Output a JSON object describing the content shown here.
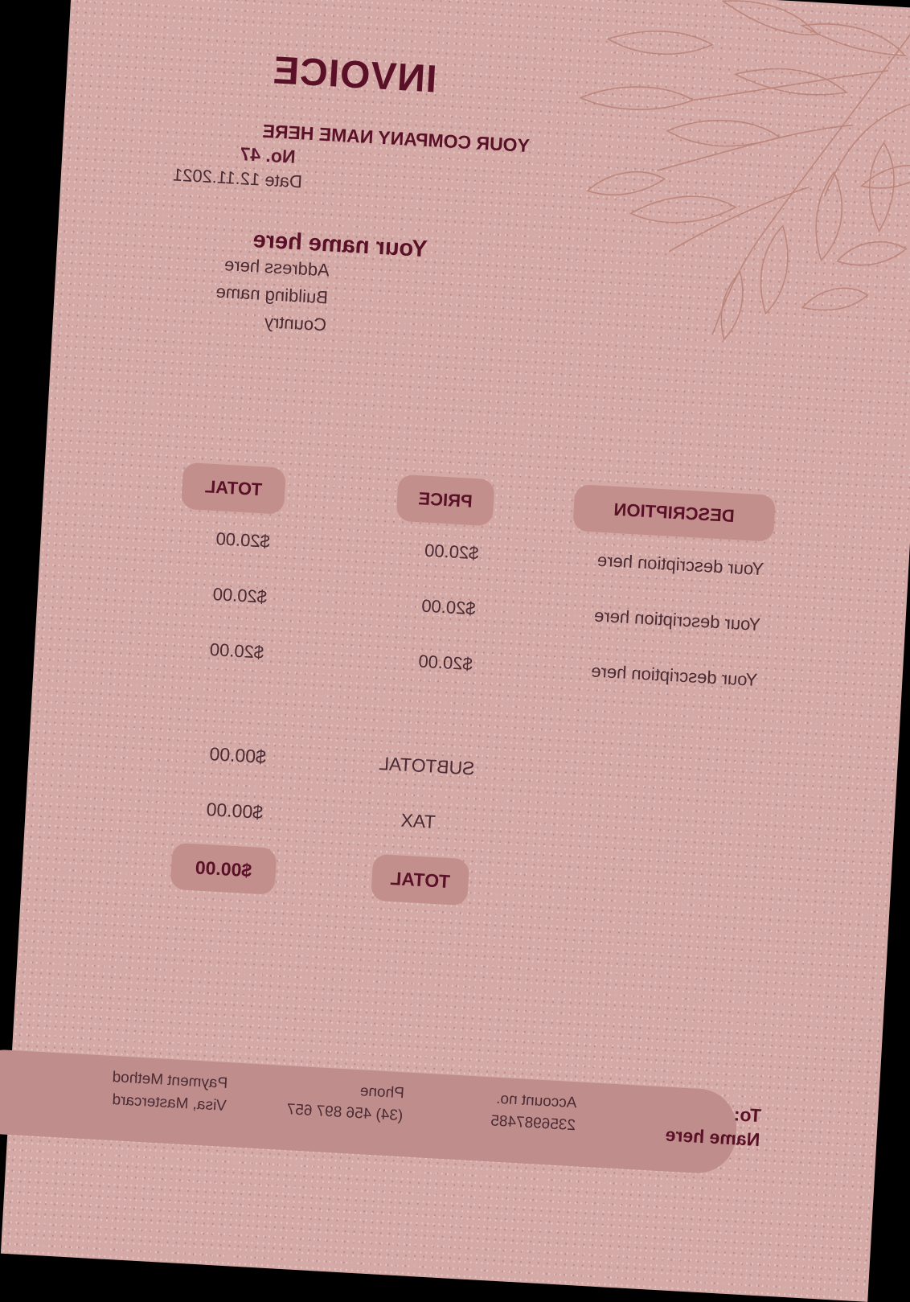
{
  "invoice": {
    "title": "INVOICE",
    "company": "YOUR COMPANY NAME HERE",
    "number": "No. 47",
    "date": "Date 12.11.2021"
  },
  "sender": {
    "name": "Your name here",
    "address": "Address here",
    "building": "Building name",
    "country": "Country"
  },
  "table": {
    "headers": [
      "DESCRIPTION",
      "PRICE",
      "TOTAL"
    ],
    "rows": [
      {
        "description": "Your description here",
        "price": "$20.00",
        "total": "$20.00"
      },
      {
        "description": "Your description here",
        "price": "$20.00",
        "total": "$20.00"
      },
      {
        "description": "Your description here",
        "price": "$20.00",
        "total": "$20.00"
      }
    ]
  },
  "summary": {
    "subtotal_label": "SUBTOTAL",
    "subtotal_value": "$00.00",
    "tax_label": "TAX",
    "tax_value": "$00.00",
    "total_label": "TOTAL",
    "total_value": "$00.00"
  },
  "footer": {
    "to_label": "To:",
    "to_name": "Name here",
    "account_label": "Account no.",
    "account_value": "2356987485",
    "phone_label": "Phone",
    "phone_value": "(34) 456 897 657",
    "payment_label": "Payment Method",
    "payment_value": "Visa, Mastercard"
  },
  "colors": {
    "paper": "#d4a9a6",
    "accent": "#5a1128",
    "pill": "#c28f8d"
  },
  "decoration": {
    "leaves": "leaf-branch-illustration"
  }
}
